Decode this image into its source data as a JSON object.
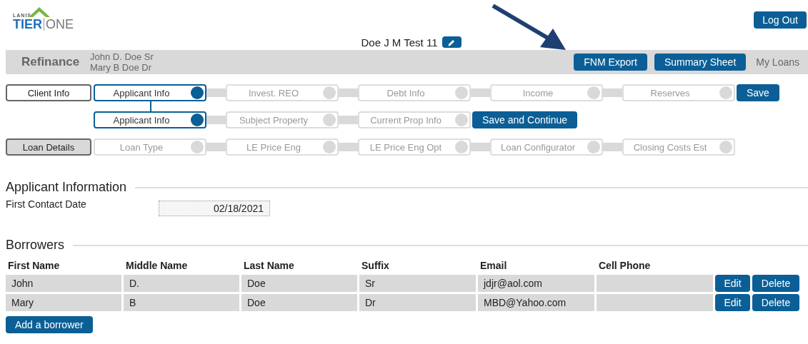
{
  "logo": {
    "small": "LANIS",
    "left": "TIER",
    "right": "ONE"
  },
  "logout": "Log Out",
  "loan_name": "Doe J M Test 11",
  "loan_bar": {
    "purpose": "Refinance",
    "borrowers": [
      "John D. Doe Sr",
      "Mary B Doe Dr"
    ],
    "buttons": [
      "FNM Export",
      "Summary Sheet"
    ],
    "link": "My Loans"
  },
  "nav_rows": [
    {
      "section": {
        "label": "Client Info",
        "selected": true
      },
      "action": "Save",
      "steps": [
        {
          "label": "Applicant Info",
          "selected": true
        },
        {
          "label": "Invest. REO",
          "selected": false
        },
        {
          "label": "Debt Info",
          "selected": false
        },
        {
          "label": "Income",
          "selected": false
        },
        {
          "label": "Reserves",
          "selected": false
        }
      ]
    },
    {
      "action": "Save and Continue",
      "steps": [
        {
          "label": "Applicant Info",
          "selected": true
        },
        {
          "label": "Subject Property",
          "selected": false
        },
        {
          "label": "Current Prop Info",
          "selected": false
        }
      ]
    },
    {
      "section": {
        "label": "Loan Details",
        "selected": false
      },
      "steps": [
        {
          "label": "Loan Type",
          "selected": false
        },
        {
          "label": "LE Price Eng",
          "selected": false
        },
        {
          "label": "LE Price Eng Opt",
          "selected": false
        },
        {
          "label": "Loan Configurator",
          "selected": false
        },
        {
          "label": "Closing Costs Est",
          "selected": false
        }
      ]
    }
  ],
  "applicant_section": {
    "title": "Applicant Information",
    "fields": [
      {
        "label": "First Contact Date",
        "value": "02/18/2021"
      }
    ]
  },
  "borrowers": {
    "title": "Borrowers",
    "columns": [
      "First Name",
      "Middle Name",
      "Last Name",
      "Suffix",
      "Email",
      "Cell Phone"
    ],
    "rows": [
      {
        "cells": [
          "John",
          "D.",
          "Doe",
          "Sr",
          "jdjr@aol.com",
          ""
        ],
        "actions": [
          "Edit",
          "Delete"
        ]
      },
      {
        "cells": [
          "Mary",
          "B",
          "Doe",
          "Dr",
          "MBD@Yahoo.com",
          ""
        ],
        "actions": [
          "Edit",
          "Delete"
        ]
      }
    ],
    "add_button": "Add a borrower"
  }
}
